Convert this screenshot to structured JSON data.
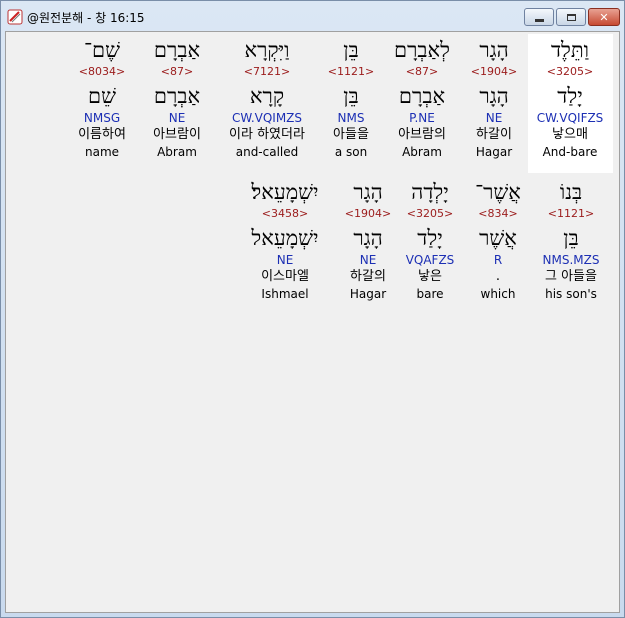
{
  "window": {
    "title": "@원전분해 - 창 16:15"
  },
  "controls": {
    "minimize": "minimize",
    "maximize": "maximize",
    "close": "✕"
  },
  "rows": [
    {
      "words": [
        {
          "heb": "וַתֵּלֶד",
          "strong": "<3205>",
          "lemma": "יָלַד",
          "morph": "CW.VQIFZS",
          "ko": "낳으매",
          "en": "And-bare",
          "highlight": true
        },
        {
          "heb": "הָגָר",
          "strong": "<1904>",
          "lemma": "הָגָר",
          "morph": "NE",
          "ko": "하갈이",
          "en": "Hagar"
        },
        {
          "heb": "לְאַבְרָם",
          "strong": "<87>",
          "lemma": "אַבְרָם",
          "morph": "P.NE",
          "ko": "아브람의",
          "en": "Abram"
        },
        {
          "heb": "בֵּן",
          "strong": "<1121>",
          "lemma": "בֵּן",
          "morph": "NMS",
          "ko": "아들을",
          "en": "a son"
        },
        {
          "heb": "וַיִּקְרָא",
          "strong": "<7121>",
          "lemma": "קָרָא",
          "morph": "CW.VQIMZS",
          "ko": "이라 하였더라",
          "en": "and-called"
        },
        {
          "heb": "אַבְרָם",
          "strong": "<87>",
          "lemma": "אַבְרָם",
          "morph": "NE",
          "ko": "아브람이",
          "en": "Abram"
        },
        {
          "heb": "שֶׁם־",
          "strong": "<8034>",
          "lemma": "שֵׁם",
          "morph": "NMSG",
          "ko": "이름하여",
          "en": "name"
        }
      ]
    },
    {
      "words": [
        {
          "heb": "בְּנוֹ",
          "strong": "<1121>",
          "lemma": "בֵּן",
          "morph": "NMS.MZS",
          "ko": "그 아들을",
          "en": "his son's"
        },
        {
          "heb": "אֲשֶׁר־",
          "strong": "<834>",
          "lemma": "אֲשֶׁר",
          "morph": "R",
          "ko": ".",
          "en": "which"
        },
        {
          "heb": "יָלְדָה",
          "strong": "<3205>",
          "lemma": "יָלַד",
          "morph": "VQAFZS",
          "ko": "낳은",
          "en": "bare"
        },
        {
          "heb": "הָגָר",
          "strong": "<1904>",
          "lemma": "הָגָר",
          "morph": "NE",
          "ko": "하갈의",
          "en": "Hagar"
        },
        {
          "heb": "יִשְׁמָעֵאל׃",
          "strong": "<3458>",
          "lemma": "יִשְׁמָעֵאל",
          "morph": "NE",
          "ko": "이스마엘",
          "en": "Ishmael"
        }
      ]
    }
  ]
}
